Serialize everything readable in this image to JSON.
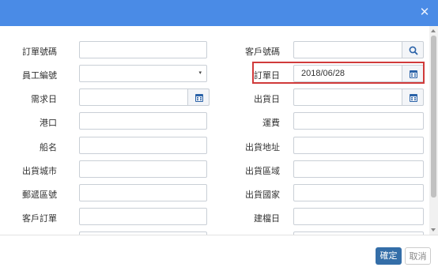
{
  "dialog": {
    "close_icon": "✕"
  },
  "form": {
    "order_no": {
      "label": "訂單號碼",
      "value": ""
    },
    "customer_no": {
      "label": "客戶號碼",
      "value": ""
    },
    "employee_no": {
      "label": "員工編號",
      "value": ""
    },
    "order_date": {
      "label": "訂單日",
      "value": "2018/06/28"
    },
    "required_date": {
      "label": "需求日",
      "value": ""
    },
    "shipped_date": {
      "label": "出貨日",
      "value": ""
    },
    "port": {
      "label": "港口",
      "value": ""
    },
    "freight": {
      "label": "運費",
      "value": ""
    },
    "ship_name": {
      "label": "船名",
      "value": ""
    },
    "ship_address": {
      "label": "出貨地址",
      "value": ""
    },
    "ship_city": {
      "label": "出貨城市",
      "value": ""
    },
    "ship_region": {
      "label": "出貨區域",
      "value": ""
    },
    "postal_code": {
      "label": "郵遞區號",
      "value": ""
    },
    "ship_country": {
      "label": "出貨國家",
      "value": ""
    },
    "customer_order": {
      "label": "客戶訂單",
      "value": ""
    },
    "created_date": {
      "label": "建檔日",
      "value": ""
    }
  },
  "icons": {
    "search": "search-icon",
    "calendar": "calendar-icon",
    "dropdown": "▾"
  },
  "colors": {
    "header": "#4a8be6",
    "confirm": "#346ea8",
    "highlight": "#d03a3a",
    "icon_blue": "#2a62a8"
  },
  "footer": {
    "ok_label": "確定",
    "cancel_label": "取消"
  }
}
